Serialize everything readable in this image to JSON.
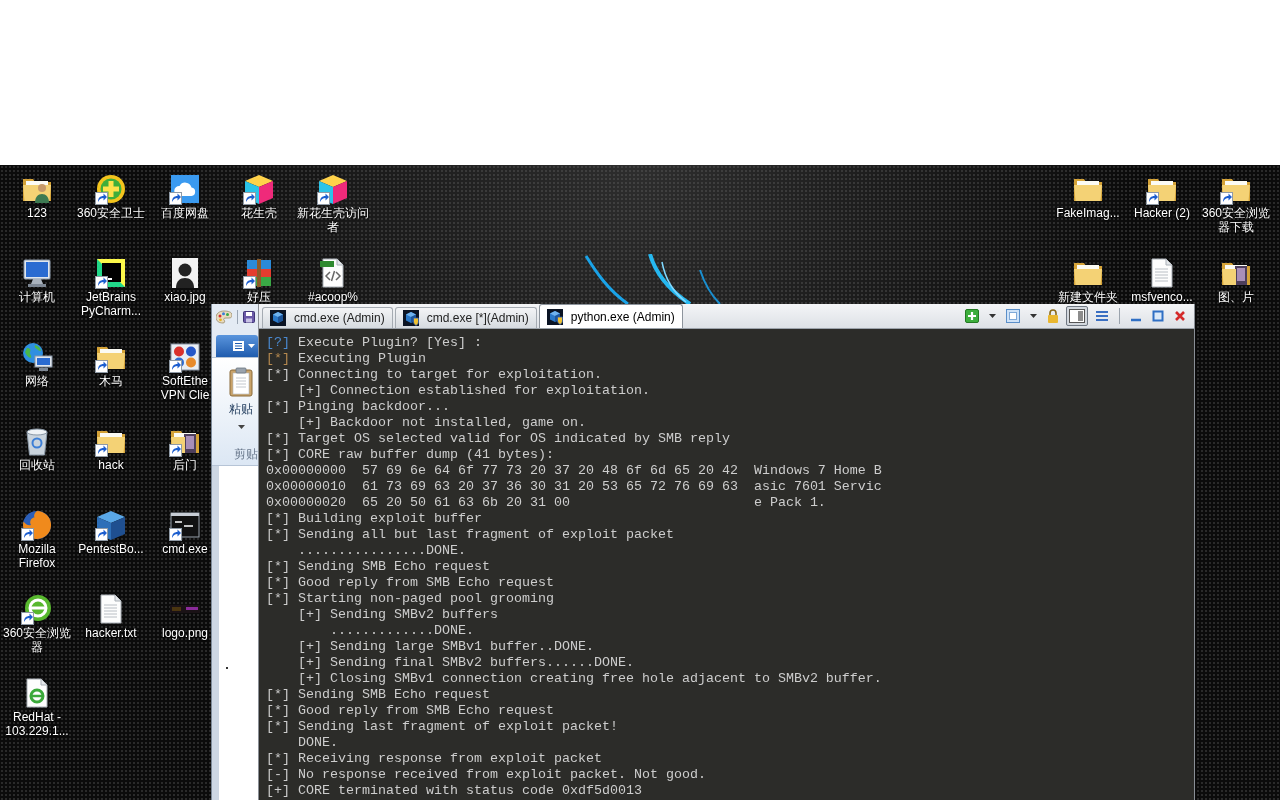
{
  "desktop": {
    "left_columns": [
      {
        "icons": [
          {
            "label": "123",
            "kind": "userfolder",
            "shortcut": false
          },
          {
            "label": "计算机",
            "kind": "monitor",
            "shortcut": false
          },
          {
            "label": "网络",
            "kind": "network",
            "shortcut": false
          },
          {
            "label": "回收站",
            "kind": "bin",
            "shortcut": false
          },
          {
            "label": "Mozilla Firefox",
            "kind": "browser",
            "shortcut": true
          },
          {
            "label": "360安全浏览器",
            "kind": "ring",
            "shortcut": true
          },
          {
            "label": "RedHat - 103.229.1...",
            "kind": "webdoc",
            "shortcut": false
          }
        ]
      },
      {
        "icons": [
          {
            "label": "360安全卫士",
            "kind": "plus",
            "shortcut": true
          },
          {
            "label": "JetBrains PyCharm...",
            "kind": "ide",
            "shortcut": true
          },
          {
            "label": "木马",
            "kind": "folder",
            "shortcut": true
          },
          {
            "label": "hack",
            "kind": "folder",
            "shortcut": true
          },
          {
            "label": "PentestBo...",
            "kind": "cube",
            "shortcut": true
          },
          {
            "label": "hacker.txt",
            "kind": "document",
            "shortcut": false
          }
        ]
      },
      {
        "icons": [
          {
            "label": "百度网盘",
            "kind": "cloud",
            "shortcut": true
          },
          {
            "label": "xiao.jpg",
            "kind": "portrait",
            "shortcut": false
          },
          {
            "label": "SoftEthe VPN Clie",
            "kind": "dots",
            "shortcut": true
          },
          {
            "label": "后门",
            "kind": "imgfolder",
            "shortcut": true
          },
          {
            "label": "cmd.exe",
            "kind": "console",
            "shortcut": true
          },
          {
            "label": "logo.png",
            "kind": "banner",
            "shortcut": false
          }
        ]
      },
      {
        "icons": [
          {
            "label": "花生壳",
            "kind": "box3d",
            "shortcut": true
          },
          {
            "label": "好压",
            "kind": "archive",
            "shortcut": true
          }
        ]
      },
      {
        "icons": [
          {
            "label": "新花生壳访问者",
            "kind": "box3d",
            "shortcut": true
          },
          {
            "label": "#acoop%",
            "kind": "script",
            "shortcut": false
          }
        ]
      }
    ],
    "right_columns": [
      {
        "icons": [
          {
            "label": "FakeImag...",
            "kind": "folder",
            "shortcut": false
          },
          {
            "label": "新建文件夹",
            "kind": "folder",
            "shortcut": false
          }
        ]
      },
      {
        "icons": [
          {
            "label": "Hacker (2)",
            "kind": "folder",
            "shortcut": true
          },
          {
            "label": "msfvenco...",
            "kind": "document",
            "shortcut": false
          }
        ]
      },
      {
        "icons": [
          {
            "label": "360安全浏览器下载",
            "kind": "folder",
            "shortcut": true
          },
          {
            "label": "图、片",
            "kind": "imgfolder",
            "shortcut": false
          }
        ]
      }
    ]
  },
  "ribbon": {
    "paste_button": "粘贴",
    "group_label": "剪贴"
  },
  "console": {
    "tabs": [
      {
        "label": "cmd.exe (Admin)",
        "kind": "plain",
        "selected": false
      },
      {
        "label": "cmd.exe [*](Admin)",
        "kind": "shield",
        "selected": false
      },
      {
        "label": "python.exe (Admin)",
        "kind": "shield",
        "selected": true
      }
    ],
    "toolbar": [
      {
        "kind": "add",
        "pressed": false
      },
      {
        "kind": "caret",
        "pressed": false
      },
      {
        "kind": "window",
        "pressed": false
      },
      {
        "kind": "caret",
        "pressed": false
      },
      {
        "kind": "lock",
        "pressed": false
      },
      {
        "kind": "panel",
        "pressed": true
      },
      {
        "kind": "list",
        "pressed": false
      }
    ],
    "lines": [
      {
        "tag": "[?]",
        "color": "#4a89cf",
        "text": "Execute Plugin? [Yes] :"
      },
      {
        "tag": "[*]",
        "color": "#b5894f",
        "text": "Executing Plugin"
      },
      {
        "text": "[*] Connecting to target for exploitation."
      },
      {
        "text": "    [+] Connection established for exploitation."
      },
      {
        "text": "[*] Pinging backdoor..."
      },
      {
        "text": "    [+] Backdoor not installed, game on."
      },
      {
        "text": "[*] Target OS selected valid for OS indicated by SMB reply"
      },
      {
        "text": "[*] CORE raw buffer dump (41 bytes):"
      },
      {
        "text": "0x00000000  57 69 6e 64 6f 77 73 20 37 20 48 6f 6d 65 20 42  Windows 7 Home B"
      },
      {
        "text": "0x00000010  61 73 69 63 20 37 36 30 31 20 53 65 72 76 69 63  asic 7601 Servic"
      },
      {
        "text": "0x00000020  65 20 50 61 63 6b 20 31 00                       e Pack 1."
      },
      {
        "text": "[*] Building exploit buffer"
      },
      {
        "text": "[*] Sending all but last fragment of exploit packet"
      },
      {
        "text": "    ................DONE."
      },
      {
        "text": "[*] Sending SMB Echo request"
      },
      {
        "text": "[*] Good reply from SMB Echo request"
      },
      {
        "text": "[*] Starting non-paged pool grooming"
      },
      {
        "text": "    [+] Sending SMBv2 buffers"
      },
      {
        "text": "        .............DONE."
      },
      {
        "text": "    [+] Sending large SMBv1 buffer..DONE."
      },
      {
        "text": "    [+] Sending final SMBv2 buffers......DONE."
      },
      {
        "text": "    [+] Closing SMBv1 connection creating free hole adjacent to SMBv2 buffer."
      },
      {
        "text": "[*] Sending SMB Echo request"
      },
      {
        "text": "[*] Good reply from SMB Echo request"
      },
      {
        "text": "[*] Sending last fragment of exploit packet!"
      },
      {
        "text": "    DONE."
      },
      {
        "text": "[*] Receiving response from exploit packet"
      },
      {
        "text": "[-] No response received from exploit packet. Not good."
      },
      {
        "text": "[+] CORE terminated with status code 0xdf5d0013"
      }
    ]
  }
}
